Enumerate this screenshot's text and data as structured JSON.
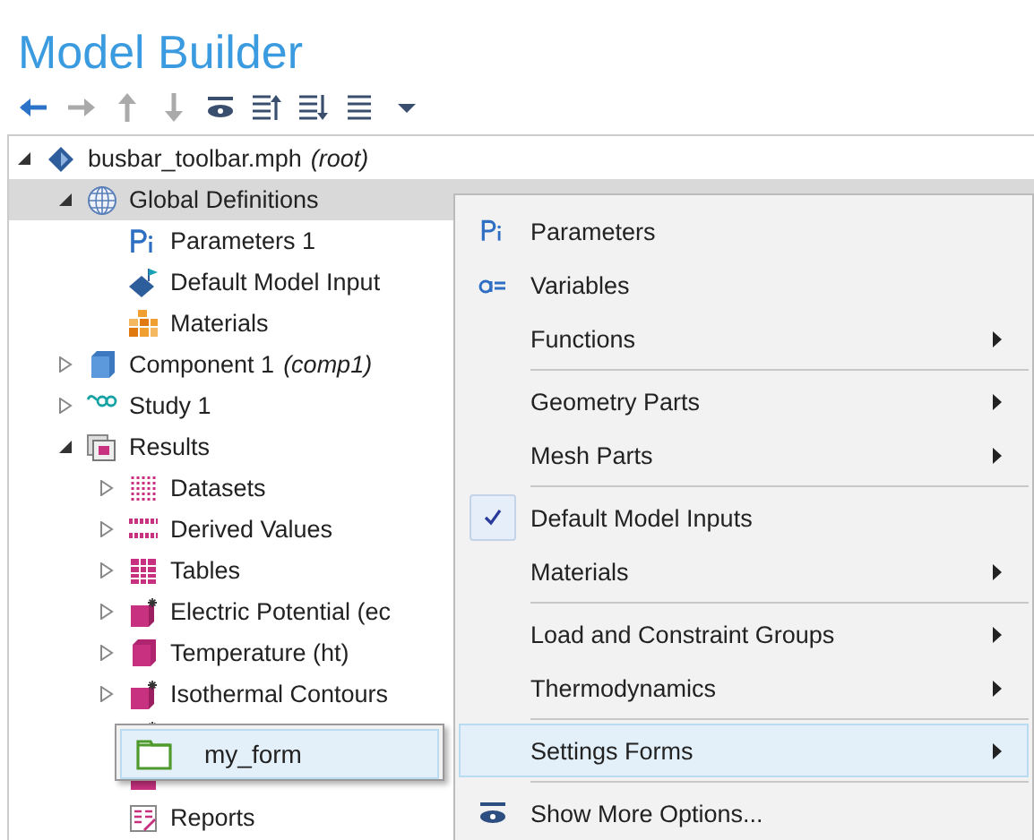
{
  "title": "Model Builder",
  "toolbar": [
    {
      "kind": "back",
      "disabled": false
    },
    {
      "kind": "forward",
      "disabled": true
    },
    {
      "kind": "up",
      "disabled": true
    },
    {
      "kind": "down",
      "disabled": true
    },
    {
      "kind": "eye"
    },
    {
      "kind": "collapse"
    },
    {
      "kind": "expand"
    },
    {
      "kind": "list"
    },
    {
      "kind": "dropdown"
    }
  ],
  "tree": [
    {
      "label": "busbar_toolbar.mph",
      "suffix": "(root)",
      "kind": "model",
      "expanded": true,
      "selected": false,
      "children": [
        {
          "label": "Global Definitions",
          "kind": "globe",
          "expanded": true,
          "selected": true,
          "children": [
            {
              "label": "Parameters 1",
              "kind": "parameters",
              "selected": false
            },
            {
              "label": "Default Model Input",
              "kind": "inputs",
              "selected": false
            },
            {
              "label": "Materials",
              "kind": "materials",
              "selected": false
            }
          ]
        },
        {
          "label": "Component 1",
          "suffix": "(comp1)",
          "kind": "component",
          "expanded": false,
          "selected": false
        },
        {
          "label": "Study 1",
          "kind": "study",
          "expanded": false,
          "selected": false
        },
        {
          "label": "Results",
          "kind": "results",
          "expanded": true,
          "selected": false,
          "children": [
            {
              "label": "Datasets",
              "kind": "datasets",
              "expanded": false,
              "selected": false
            },
            {
              "label": "Derived Values",
              "kind": "derived",
              "expanded": false,
              "selected": false
            },
            {
              "label": "Tables",
              "kind": "tables",
              "expanded": false,
              "selected": false
            },
            {
              "label": "Electric Potential (ec",
              "kind": "plot-star",
              "expanded": false,
              "selected": false
            },
            {
              "label": "Temperature (ht)",
              "kind": "plot",
              "expanded": false,
              "selected": false
            },
            {
              "label": "Isothermal Contours",
              "kind": "plot-star",
              "expanded": false,
              "selected": false
            },
            {
              "kind": "plot-star",
              "selected": false
            },
            {
              "kind": "export",
              "selected": false
            },
            {
              "label": "Reports",
              "kind": "reports",
              "selected": false
            }
          ]
        }
      ]
    }
  ],
  "menu": {
    "groups": [
      [
        {
          "label": "Parameters",
          "kind": "parameters",
          "submenu": false,
          "checked": false,
          "selected": false
        },
        {
          "label": "Variables",
          "kind": "variables",
          "submenu": false,
          "checked": false,
          "selected": false
        },
        {
          "label": "Functions",
          "submenu": true,
          "checked": false,
          "selected": false
        }
      ],
      [
        {
          "label": "Geometry Parts",
          "submenu": true,
          "checked": false,
          "selected": false
        },
        {
          "label": "Mesh Parts",
          "submenu": true,
          "checked": false,
          "selected": false
        }
      ],
      [
        {
          "label": "Default Model Inputs",
          "submenu": false,
          "checked": true,
          "selected": false
        },
        {
          "label": "Materials",
          "submenu": true,
          "checked": false,
          "selected": false
        }
      ],
      [
        {
          "label": "Load and Constraint Groups",
          "submenu": true,
          "checked": false,
          "selected": false
        },
        {
          "label": "Thermodynamics",
          "submenu": true,
          "checked": false,
          "selected": false
        }
      ],
      [
        {
          "label": "Settings Forms",
          "submenu": true,
          "checked": false,
          "selected": true
        }
      ],
      [
        {
          "label": "Show More Options...",
          "kind": "eye",
          "submenu": false,
          "checked": false,
          "selected": false
        }
      ]
    ]
  },
  "submenu": {
    "items": [
      {
        "label": "my_form",
        "kind": "folder",
        "selected": true
      }
    ]
  }
}
